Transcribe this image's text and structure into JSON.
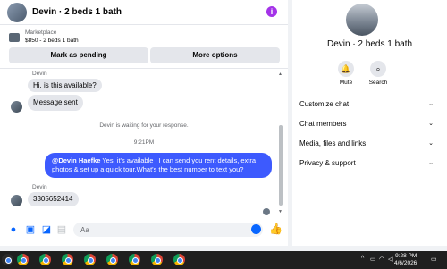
{
  "header": {
    "title": "Devin · 2 beds 1 bath"
  },
  "marketplace": {
    "label": "Marketplace",
    "price_title": "$850 - 2 beds 1 bath"
  },
  "actions": {
    "pending": "Mark as pending",
    "more": "More options"
  },
  "messages": {
    "sender1": "Devin",
    "msg1": "Hi, is this available?",
    "msg2": "Message sent",
    "system": "Devin is waiting for your response.",
    "time": "9:21PM",
    "out_mention": "@Devin Haefke",
    "out_text": " Yes, it's available .  I can send you rent details, extra photos & set up a quick tour.What's the best number to text you?",
    "sender2": "Devin",
    "msg3": "3305652414"
  },
  "composer": {
    "placeholder": "Aa"
  },
  "side": {
    "name": "Devin · 2 beds 1 bath",
    "mute": "Mute",
    "search": "Search",
    "sections": [
      "Customize chat",
      "Chat members",
      "Media, files and links",
      "Privacy & support"
    ]
  },
  "taskbar": {
    "time": "9:28 PM",
    "date": "4/6/2026"
  },
  "colors": {
    "accent": "#0866ff",
    "outgoing": "#3d5afe",
    "info": "#a433e8"
  }
}
